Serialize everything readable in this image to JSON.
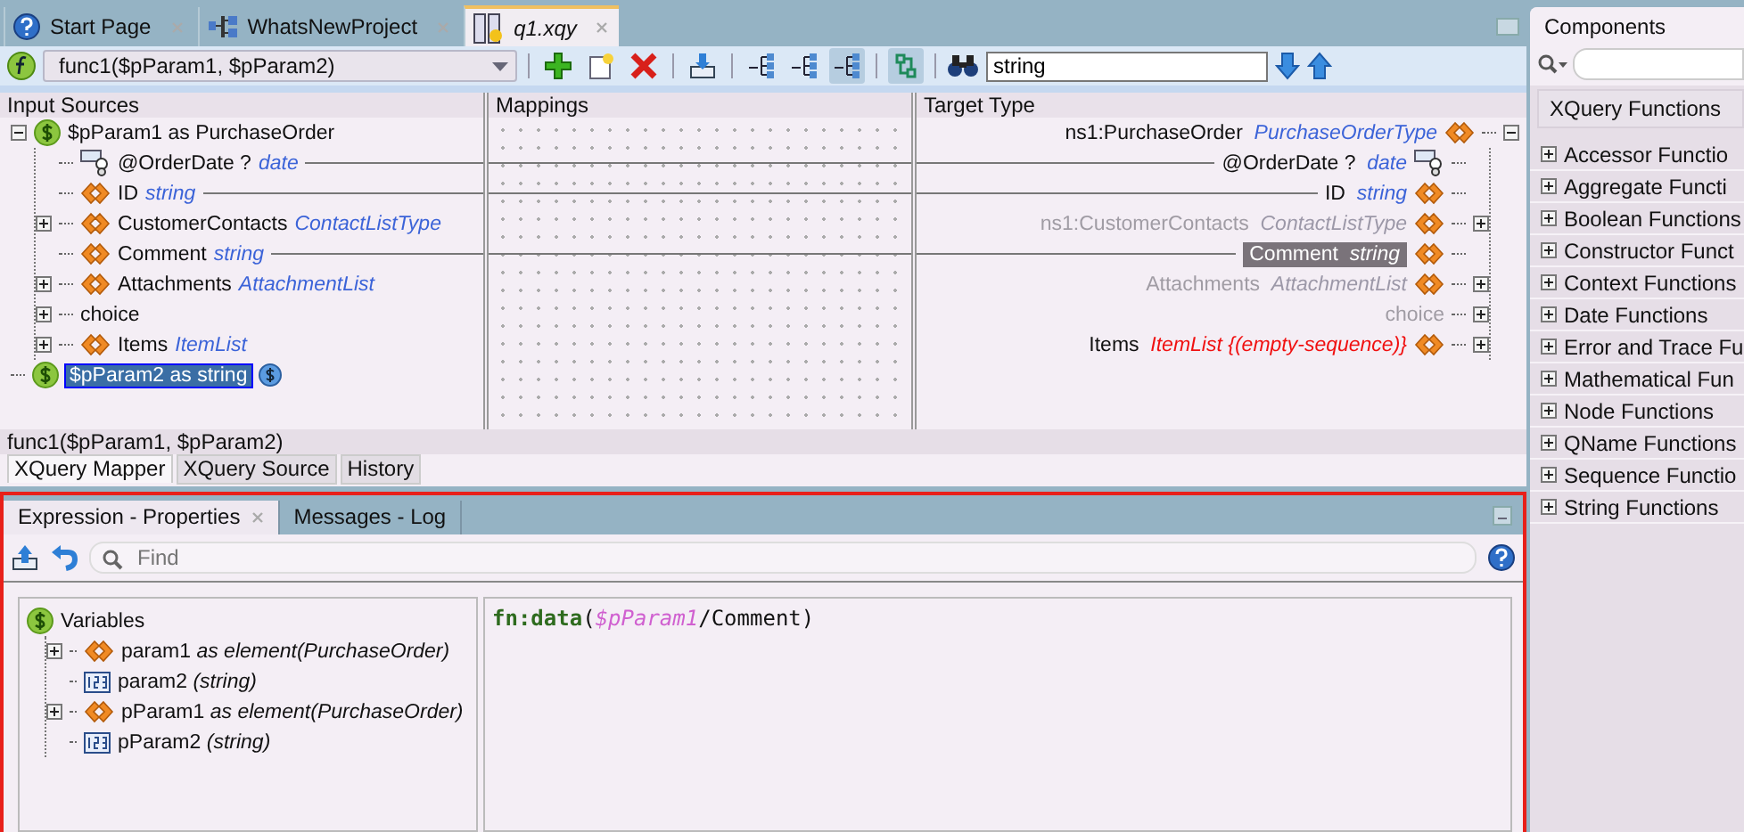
{
  "editor_tabs": [
    {
      "label": "Start Page",
      "kind": "help",
      "selected": false
    },
    {
      "label": "WhatsNewProject",
      "kind": "project",
      "selected": false
    },
    {
      "label": "q1.xqy",
      "kind": "xquery",
      "selected": true
    }
  ],
  "toolbar": {
    "function": "func1($pParam1, $pParam2)",
    "buttons": [
      {
        "kind": "add",
        "pressed": false
      },
      {
        "kind": "new",
        "pressed": false
      },
      {
        "kind": "delete",
        "pressed": false
      },
      {
        "kind": "import",
        "pressed": false
      },
      {
        "kind": "tree-a",
        "pressed": false
      },
      {
        "kind": "tree-b",
        "pressed": false
      },
      {
        "kind": "tree-c",
        "pressed": true
      },
      {
        "kind": "link",
        "pressed": true
      }
    ],
    "search": {
      "value": "string"
    }
  },
  "mapper": {
    "columns": [
      "Input Sources",
      "Mappings",
      "Target Type"
    ],
    "source_tree": [
      {
        "name": "$pParam1 as PurchaseOrder",
        "kind": "param",
        "expanded": true,
        "selected": false,
        "children": [
          {
            "name": "@OrderDate ?",
            "type": "date",
            "kind": "attribute",
            "mapped": true,
            "selected": false
          },
          {
            "name": "ID",
            "type": "string",
            "kind": "element",
            "mapped": true,
            "selected": false
          },
          {
            "name": "CustomerContacts",
            "type": "ContactListType",
            "kind": "element",
            "expanded": false,
            "mapped": false,
            "selected": false
          },
          {
            "name": "Comment",
            "type": "string",
            "kind": "element",
            "mapped": true,
            "selected": false
          },
          {
            "name": "Attachments",
            "type": "AttachmentList",
            "kind": "element",
            "expanded": false,
            "mapped": false,
            "selected": false
          },
          {
            "name": "choice",
            "kind": "choice",
            "expanded": false,
            "mapped": false,
            "selected": false
          },
          {
            "name": "Items",
            "type": "ItemList",
            "kind": "element",
            "expanded": false,
            "mapped": false,
            "selected": false
          }
        ]
      },
      {
        "name": "$pParam2 as string",
        "kind": "param",
        "selected": true
      }
    ],
    "target_tree": [
      {
        "name": "ns1:PurchaseOrder",
        "type": "PurchaseOrderType",
        "kind": "element",
        "expanded": true,
        "children": [
          {
            "name": "@OrderDate ?",
            "type": "date",
            "kind": "attribute",
            "mapped": true,
            "greyed": false,
            "error": false,
            "selected": false
          },
          {
            "name": "ID",
            "type": "string",
            "kind": "element",
            "mapped": true,
            "greyed": false,
            "error": false,
            "selected": false
          },
          {
            "name": "ns1:CustomerContacts",
            "type": "ContactListType",
            "kind": "element",
            "mapped": false,
            "greyed": true,
            "error": false,
            "expanded": false,
            "selected": false
          },
          {
            "name": "Comment",
            "type": "string",
            "kind": "element",
            "mapped": true,
            "greyed": false,
            "error": false,
            "selected": true
          },
          {
            "name": "Attachments",
            "type": "AttachmentList",
            "kind": "element",
            "mapped": false,
            "greyed": true,
            "error": false,
            "expanded": false,
            "selected": false
          },
          {
            "name": "choice",
            "kind": "choice",
            "mapped": false,
            "greyed": true,
            "expanded": false,
            "selected": false
          },
          {
            "name": "Items",
            "type": "ItemList {(empty-sequence)}",
            "kind": "element",
            "mapped": false,
            "greyed": false,
            "error": true,
            "expanded": false,
            "selected": false
          }
        ]
      }
    ]
  },
  "function_signature": "func1($pParam1, $pParam2)",
  "view_tabs": [
    {
      "label": "XQuery Mapper",
      "selected": true
    },
    {
      "label": "XQuery Source",
      "selected": false
    },
    {
      "label": "History",
      "selected": false
    }
  ],
  "properties_panel": {
    "tabs": [
      {
        "label": "Expression - Properties",
        "selected": true
      },
      {
        "label": "Messages - Log",
        "selected": false
      }
    ],
    "find": {
      "placeholder": "Find"
    },
    "variables": {
      "label": "Variables",
      "children": [
        {
          "name": "param1",
          "type": "as element(PurchaseOrder)",
          "kind": "element",
          "expanded": false
        },
        {
          "name": "param2",
          "type": "(string)",
          "kind": "number"
        },
        {
          "name": "pParam1",
          "type": "as element(PurchaseOrder)",
          "kind": "element",
          "expanded": false
        },
        {
          "name": "pParam2",
          "type": "(string)",
          "kind": "number"
        }
      ]
    },
    "expression": [
      {
        "text": "fn:data",
        "kind": "function"
      },
      {
        "text": "(",
        "kind": "plain"
      },
      {
        "text": "$pParam1",
        "kind": "variable"
      },
      {
        "text": "/Comment)",
        "kind": "plain"
      }
    ]
  },
  "components_panel": {
    "title": "Components",
    "category": "XQuery Functions",
    "items": [
      {
        "label": "Accessor Functio",
        "expanded": false
      },
      {
        "label": "Aggregate Functi",
        "expanded": false
      },
      {
        "label": "Boolean Functions",
        "expanded": false
      },
      {
        "label": "Constructor Funct",
        "expanded": false
      },
      {
        "label": "Context Functions",
        "expanded": false
      },
      {
        "label": "Date Functions",
        "expanded": false
      },
      {
        "label": "Error and Trace Fu",
        "expanded": false
      },
      {
        "label": "Mathematical Fun",
        "expanded": false
      },
      {
        "label": "Node Functions",
        "expanded": false
      },
      {
        "label": "QName Functions",
        "expanded": false
      },
      {
        "label": "Sequence Functio",
        "expanded": false
      },
      {
        "label": "String Functions",
        "expanded": false
      }
    ]
  }
}
